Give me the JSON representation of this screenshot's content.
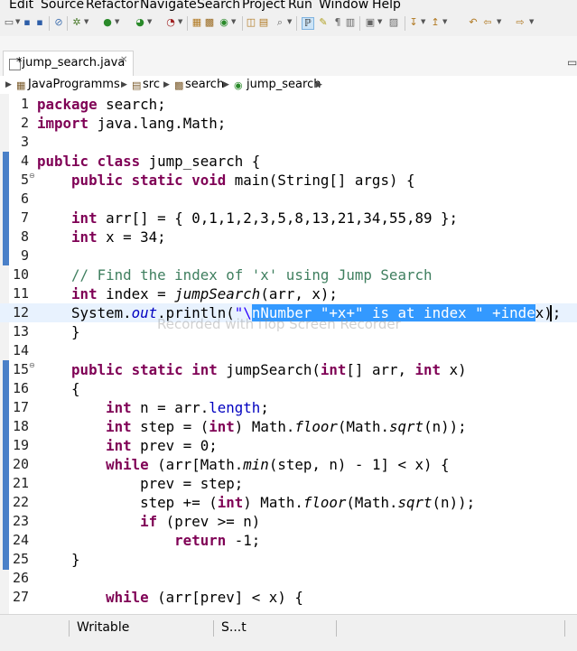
{
  "menubar": {
    "items": [
      "Edit",
      "Source",
      "Refactor",
      "Navigate",
      "Search",
      "Project",
      "Run",
      "Window",
      "Help"
    ]
  },
  "toolbar": {
    "icons": [
      "new-icon",
      "save-icon",
      "save-all-icon",
      "skip-breakpoints-icon",
      "debug-icon",
      "run-icon",
      "coverage-icon",
      "external-tools-icon",
      "new-java-project-icon",
      "new-package-icon",
      "new-class-icon",
      "open-type-icon",
      "search-icon",
      "toggle-mark-occurrences-icon",
      "next-annotation-icon",
      "previous-annotation-icon",
      "back-icon",
      "forward-icon"
    ]
  },
  "editor_tab": {
    "label": "*jump_search.java",
    "close": "✕"
  },
  "breadcrumb": {
    "items": [
      "JavaProgramms",
      "src",
      "search",
      "jump_search"
    ]
  },
  "editor": {
    "lines": [
      {
        "n": "1",
        "code": "package search;"
      },
      {
        "n": "2",
        "code": "import java.lang.Math;"
      },
      {
        "n": "3",
        "code": ""
      },
      {
        "n": "4",
        "code": "public class jump_search {"
      },
      {
        "n": "5",
        "code": "    public static void main(String[] args) {"
      },
      {
        "n": "6",
        "code": ""
      },
      {
        "n": "7",
        "code": "    int arr[] = { 0,1,1,2,3,5,8,13,21,34,55,89 };"
      },
      {
        "n": "8",
        "code": "    int x = 34;"
      },
      {
        "n": "9",
        "code": ""
      },
      {
        "n": "10",
        "code": "    // Find the index of 'x' using Jump Search"
      },
      {
        "n": "11",
        "code": "    int index = jumpSearch(arr, x);"
      },
      {
        "n": "12",
        "code": "    System.out.println(\"\\nNumber \"+x+\" is at index \" +index);"
      },
      {
        "n": "13",
        "code": "    }"
      },
      {
        "n": "14",
        "code": ""
      },
      {
        "n": "15",
        "code": "    public static int jumpSearch(int[] arr, int x)"
      },
      {
        "n": "16",
        "code": "    {"
      },
      {
        "n": "17",
        "code": "        int n = arr.length;"
      },
      {
        "n": "18",
        "code": "        int step = (int) Math.floor(Math.sqrt(n));"
      },
      {
        "n": "19",
        "code": "        int prev = 0;"
      },
      {
        "n": "20",
        "code": "        while (arr[Math.min(step, n) - 1] < x) {"
      },
      {
        "n": "21",
        "code": "            prev = step;"
      },
      {
        "n": "22",
        "code": "            step += (int) Math.floor(Math.sqrt(n));"
      },
      {
        "n": "23",
        "code": "            if (prev >= n)"
      },
      {
        "n": "24",
        "code": "                return -1;"
      },
      {
        "n": "25",
        "code": "    }"
      },
      {
        "n": "26",
        "code": ""
      },
      {
        "n": "27",
        "code": "        while (arr[prev] < x) {"
      }
    ],
    "current_line": "12",
    "selection": "nNumber \"+x+\" is at index \" +inde"
  },
  "watermark": "Recorded with iTop Screen Recorder",
  "statusbar": {
    "writable": "Writable",
    "smart_insert": "S...t"
  },
  "colors": {
    "keyword": "#7f0055",
    "comment": "#3f7f5f",
    "string": "#2a00ff",
    "field": "#0000c0",
    "selection": "#3399ff",
    "current_line": "#e8f2fe",
    "ruler_mark": "#4a80c8"
  }
}
